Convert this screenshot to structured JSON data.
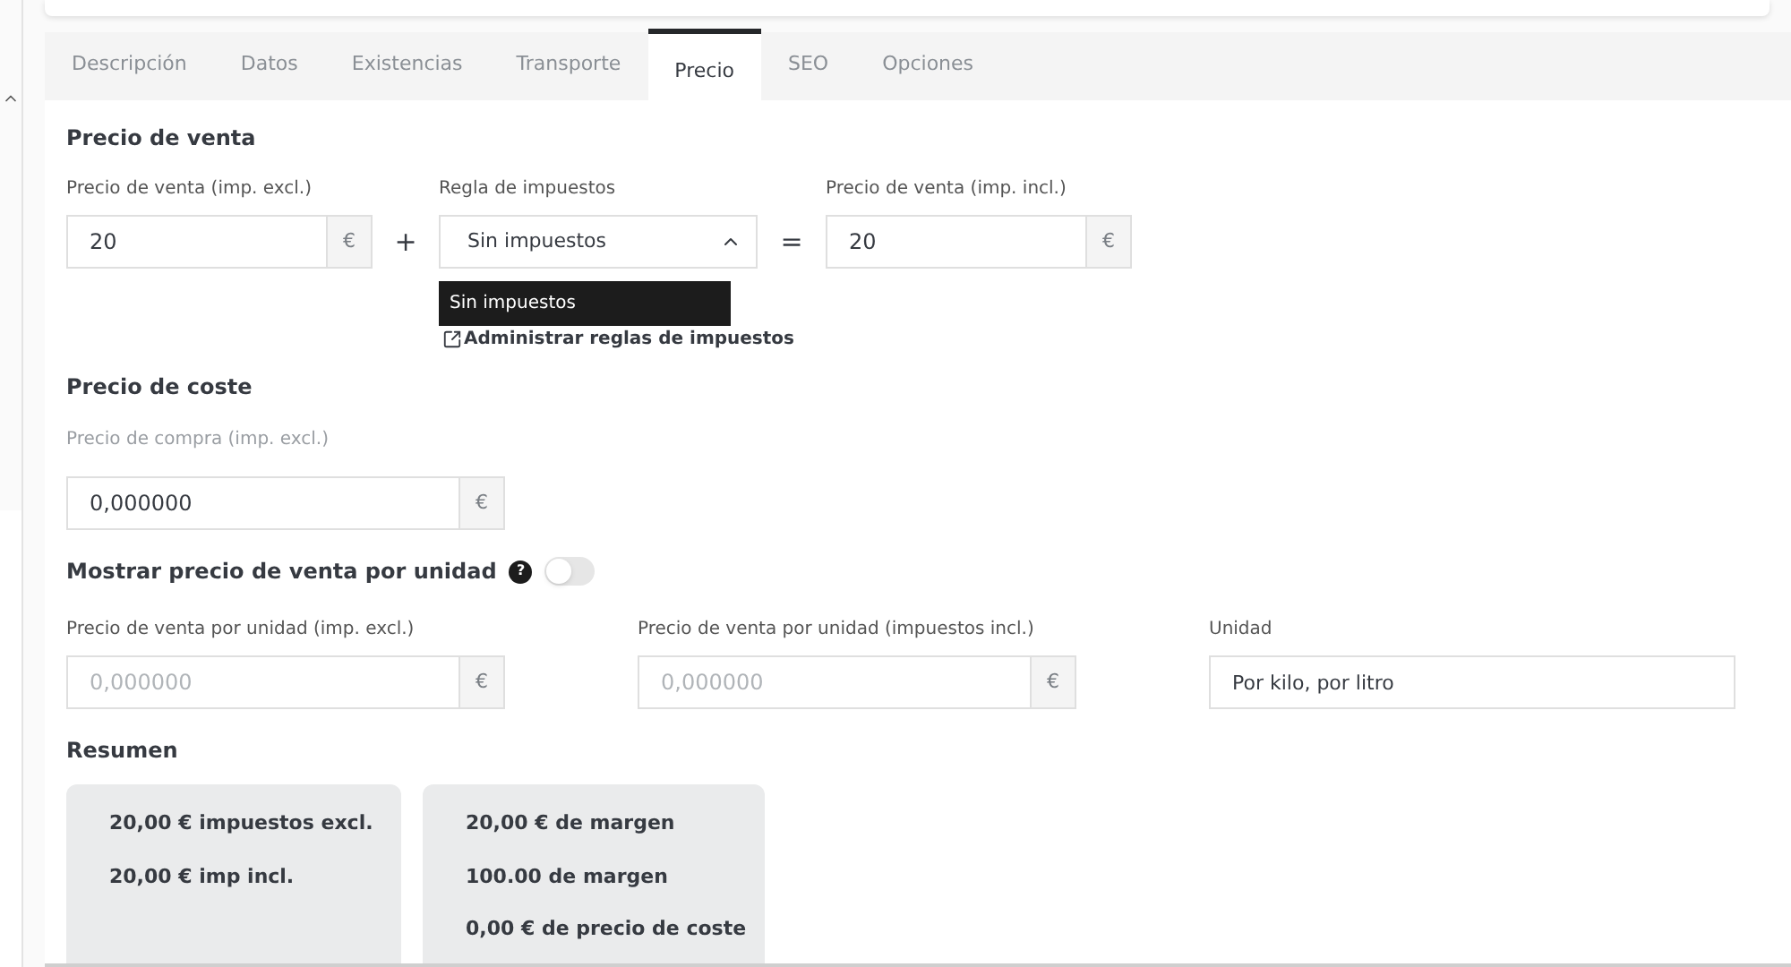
{
  "tabs": [
    {
      "label": "Descripción",
      "selected": false
    },
    {
      "label": "Datos",
      "selected": false
    },
    {
      "label": "Existencias",
      "selected": false
    },
    {
      "label": "Transporte",
      "selected": false
    },
    {
      "label": "Precio",
      "selected": true
    },
    {
      "label": "SEO",
      "selected": false
    },
    {
      "label": "Opciones",
      "selected": false
    }
  ],
  "sale_price": {
    "heading": "Precio de venta",
    "excl": {
      "label": "Precio de venta (imp. excl.)",
      "value": "20",
      "suffix": "€"
    },
    "plus": "+",
    "tax_rule": {
      "label": "Regla de impuestos",
      "value": "Sin impuestos",
      "expanded": true,
      "options": [
        {
          "label": "Sin impuestos",
          "selected": true
        }
      ],
      "manage_link": "Administrar reglas de impuestos"
    },
    "equals": "=",
    "incl": {
      "label": "Precio de venta (imp. incl.)",
      "value": "20",
      "suffix": "€"
    }
  },
  "cost_price": {
    "heading": "Precio de coste",
    "purchase": {
      "label": "Precio de compra (imp. excl.)",
      "value": "0,000000",
      "suffix": "€"
    }
  },
  "unit_price": {
    "heading": "Mostrar precio de venta por unidad",
    "help": "?",
    "on": false,
    "fields": [
      {
        "label": "Precio de venta por unidad (imp. excl.)",
        "placeholder": "0,000000",
        "suffix": "€"
      },
      {
        "label": "Precio de venta por unidad (impuestos incl.)",
        "placeholder": "0,000000",
        "suffix": "€"
      },
      {
        "label": "Unidad",
        "value": "Por kilo, por litro"
      }
    ]
  },
  "summary": {
    "heading": "Resumen",
    "cards": [
      [
        "20,00 € impuestos excl.",
        "20,00 € imp incl."
      ],
      [
        "20,00 € de margen",
        "100.00 de margen",
        "0,00 € de precio de coste"
      ]
    ]
  }
}
